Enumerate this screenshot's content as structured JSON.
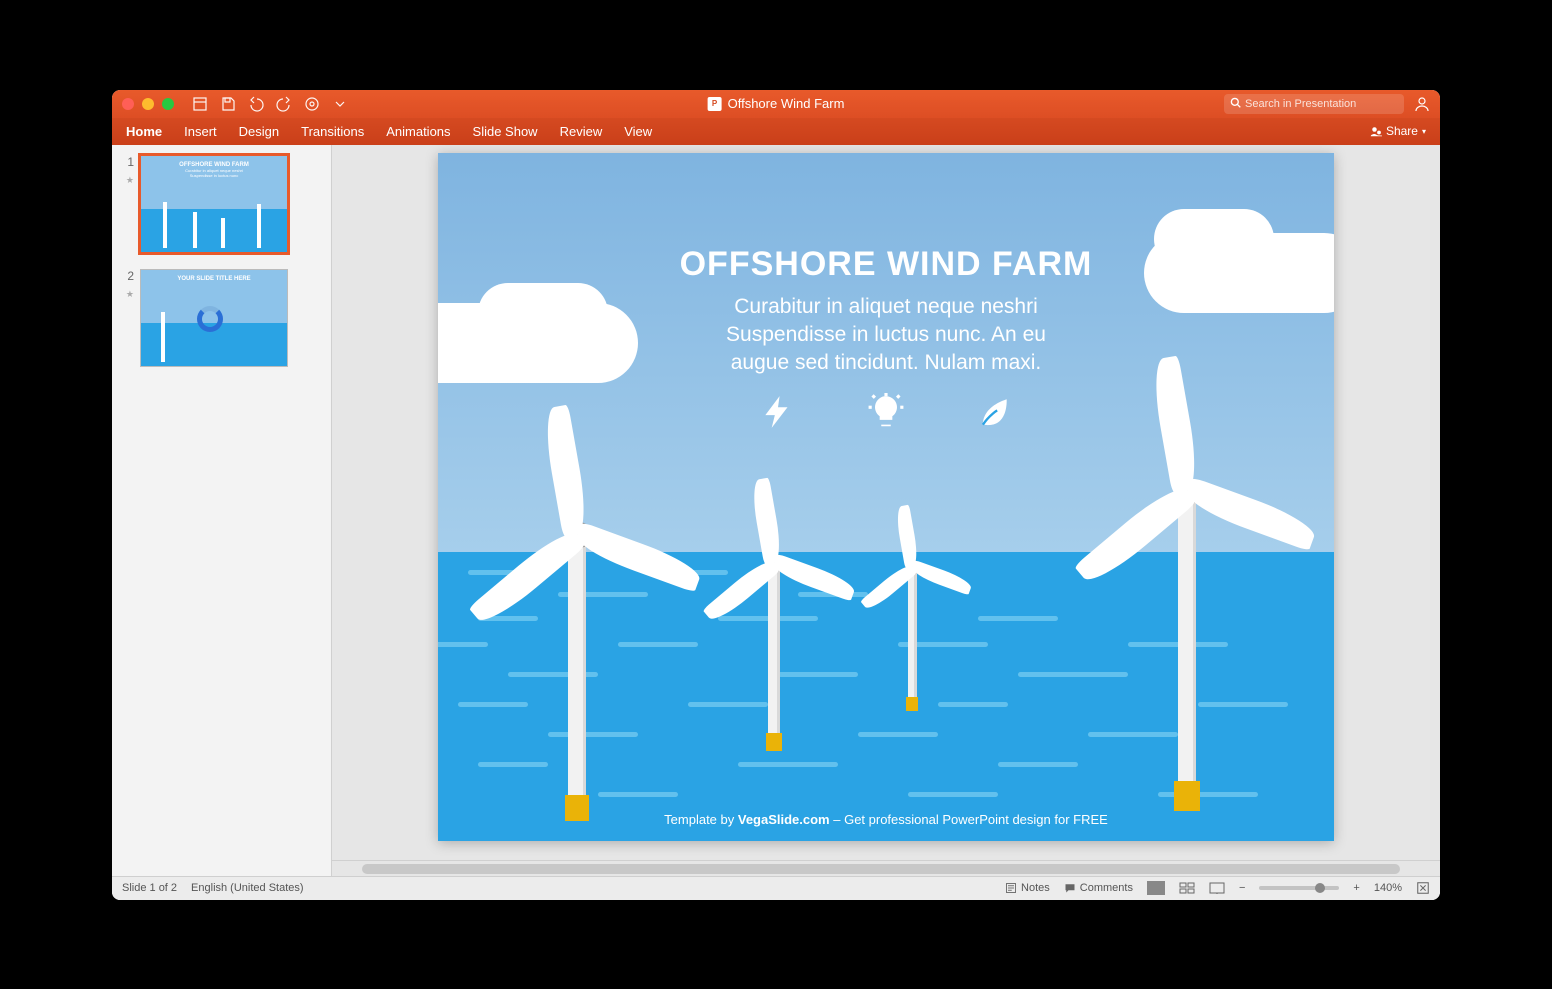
{
  "title": "Offshore Wind Farm",
  "search": {
    "placeholder": "Search in Presentation"
  },
  "ribbon": {
    "tabs": [
      "Home",
      "Insert",
      "Design",
      "Transitions",
      "Animations",
      "Slide Show",
      "Review",
      "View"
    ],
    "share": "Share"
  },
  "thumbnails": {
    "slide1_num": "1",
    "slide2_num": "2",
    "slide1_title": "OFFSHORE WIND FARM",
    "slide2_title": "YOUR SLIDE TITLE HERE"
  },
  "slide": {
    "title": "OFFSHORE WIND FARM",
    "lead1": "Curabitur in aliquet neque neshri",
    "lead2": "Suspendisse in luctus nunc. An eu",
    "lead3": "augue sed tincidunt. Nulam maxi.",
    "footer_pre": "Template by ",
    "footer_site": "VegaSlide.com",
    "footer_post": " – Get professional PowerPoint design for FREE"
  },
  "status": {
    "slide": "Slide 1 of 2",
    "lang": "English (United States)",
    "notes": "Notes",
    "comments": "Comments",
    "zoom": "140%"
  }
}
